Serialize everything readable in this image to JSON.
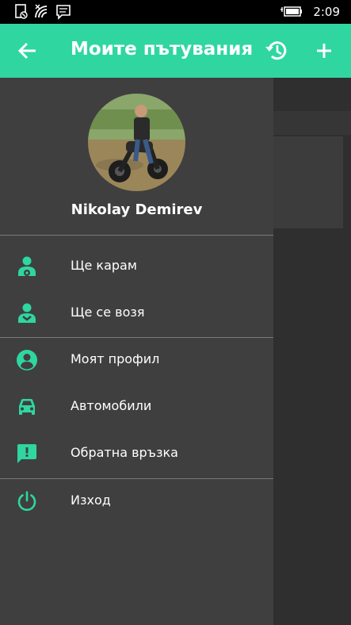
{
  "status_bar": {
    "time": "2:09",
    "icons": [
      "ringer-icon",
      "wifi-icon",
      "message-icon",
      "battery-icon"
    ]
  },
  "app_bar": {
    "title": "Моите пътувания",
    "back_icon": "arrow-left-icon",
    "history_icon": "history-icon",
    "add_icon": "plus-icon",
    "color": "#2fd6a0"
  },
  "drawer": {
    "user_name": "Nikolay Demirev",
    "accent_color": "#2fd6a0",
    "menu": [
      {
        "label": "Ще карам",
        "icon": "driver-icon"
      },
      {
        "label": "Ще се возя",
        "icon": "passenger-icon"
      },
      {
        "label": "Моят профил",
        "icon": "account-circle-icon"
      },
      {
        "label": "Автомобили",
        "icon": "car-icon"
      },
      {
        "label": "Обратна връзка",
        "icon": "feedback-icon"
      },
      {
        "label": "Изход",
        "icon": "power-icon"
      }
    ]
  }
}
